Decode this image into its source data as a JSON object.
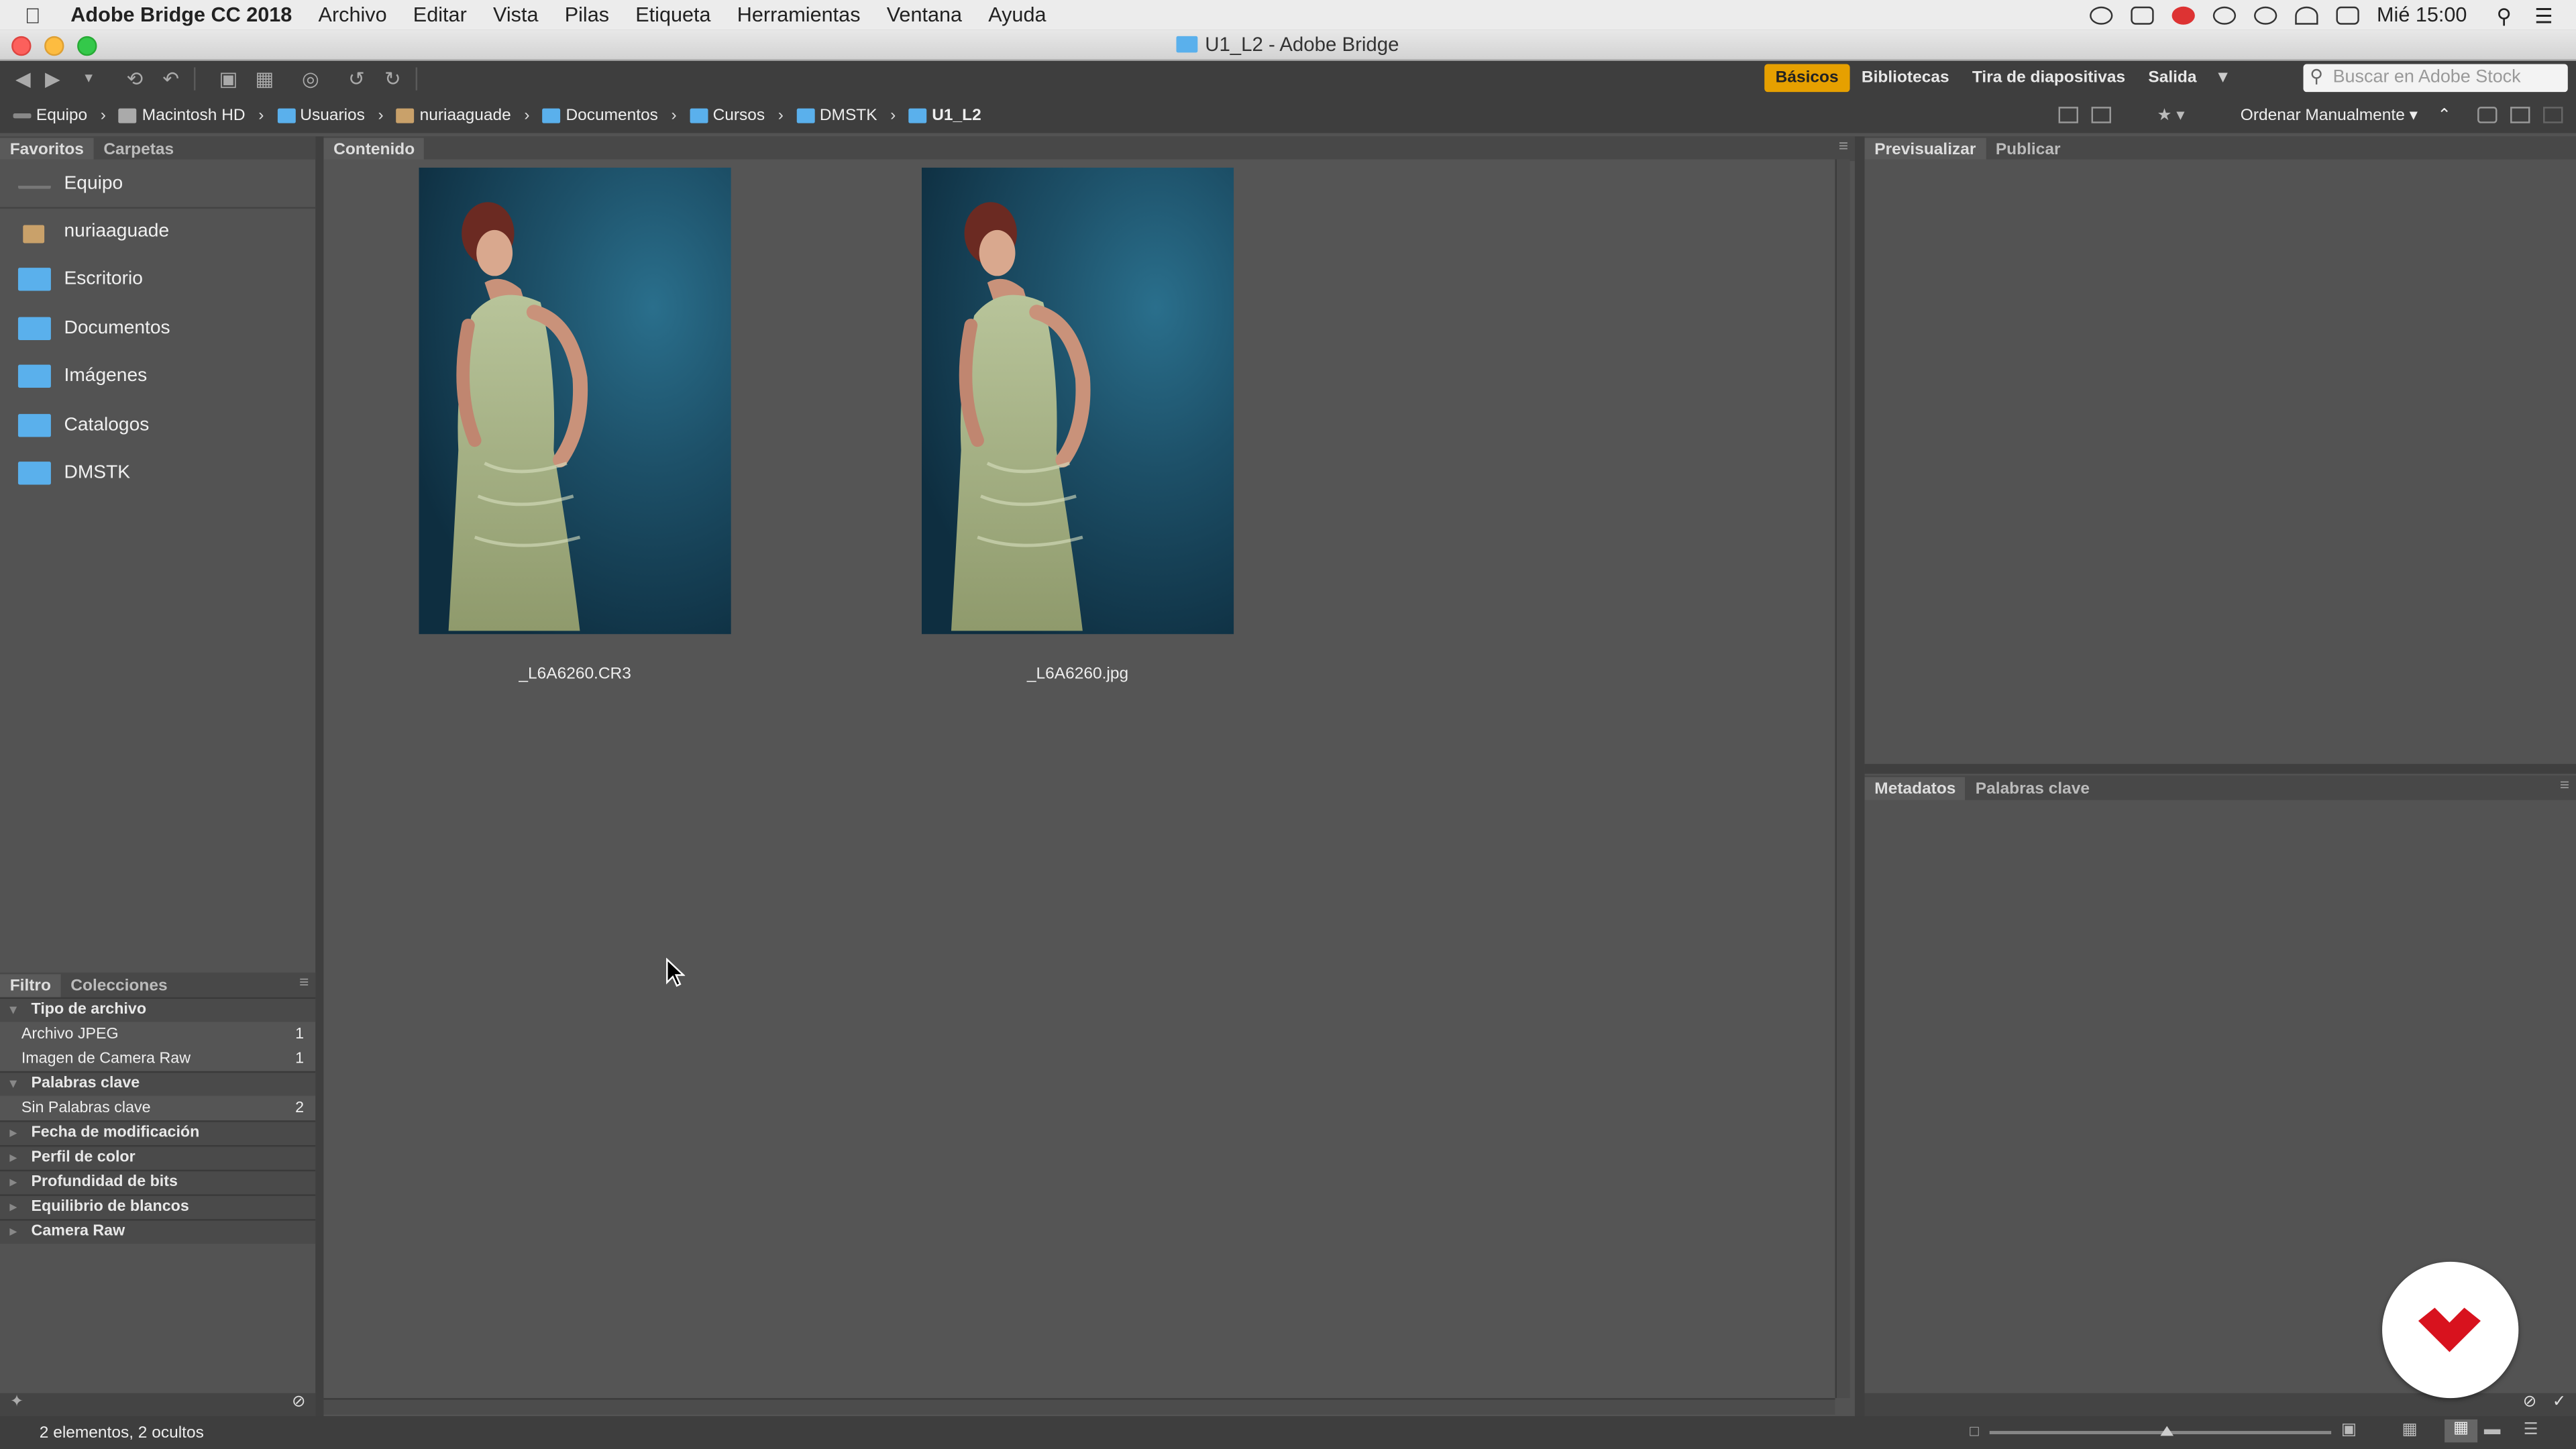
{
  "menubar": {
    "app": "Adobe Bridge CC 2018",
    "items": [
      "Archivo",
      "Editar",
      "Vista",
      "Pilas",
      "Etiqueta",
      "Herramientas",
      "Ventana",
      "Ayuda"
    ],
    "clock": "Mié 15:00"
  },
  "window": {
    "title": "U1_L2 - Adobe Bridge"
  },
  "workspaces": {
    "items": [
      "Básicos",
      "Bibliotecas",
      "Tira de diapositivas",
      "Salida"
    ],
    "active": "Básicos"
  },
  "search": {
    "placeholder": "Buscar en Adobe Stock"
  },
  "breadcrumb": [
    "Equipo",
    "Macintosh HD",
    "Usuarios",
    "nuriaaguade",
    "Documentos",
    "Cursos",
    "DMSTK",
    "U1_L2"
  ],
  "sort": {
    "label": "Ordenar Manualmente"
  },
  "left_tabs": {
    "favorites": "Favoritos",
    "folders": "Carpetas"
  },
  "favorites": [
    "Equipo",
    "nuriaaguade",
    "Escritorio",
    "Documentos",
    "Imágenes",
    "Catalogos",
    "DMSTK"
  ],
  "filter_tabs": {
    "filter": "Filtro",
    "collections": "Colecciones"
  },
  "filter": {
    "file_type": {
      "title": "Tipo de archivo",
      "rows": [
        {
          "label": "Archivo JPEG",
          "count": "1"
        },
        {
          "label": "Imagen de Camera Raw",
          "count": "1"
        }
      ]
    },
    "keywords": {
      "title": "Palabras clave",
      "rows": [
        {
          "label": "Sin Palabras clave",
          "count": "2"
        }
      ]
    },
    "collapsed": [
      "Fecha de modificación",
      "Perfil de color",
      "Profundidad de bits",
      "Equilibrio de blancos",
      "Camera Raw"
    ]
  },
  "content": {
    "tab": "Contenido",
    "items": [
      {
        "name": "_L6A6260.CR3"
      },
      {
        "name": "_L6A6260.jpg"
      }
    ]
  },
  "preview_tabs": {
    "preview": "Previsualizar",
    "publish": "Publicar"
  },
  "meta_tabs": {
    "metadata": "Metadatos",
    "keywords": "Palabras clave"
  },
  "status": {
    "text": "2 elementos, 2 ocultos"
  },
  "thumbnail_zoom": 0.52
}
